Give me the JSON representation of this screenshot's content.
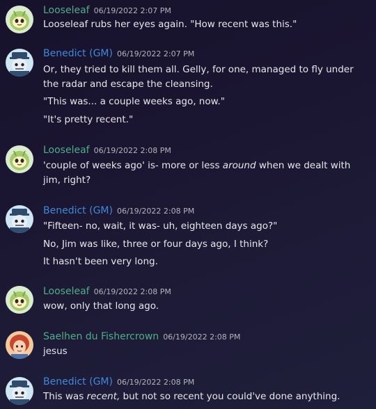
{
  "colors": {
    "loose_name": "#4fae88",
    "gm_name": "#3f89d8",
    "saelhen_name": "#4fae88",
    "text": "#e6e7eb",
    "timestamp": "#b2b4bd"
  },
  "messages": [
    {
      "author": "Looseleaf",
      "timestamp": "06/19/2022 2:07 PM",
      "lines": [
        "Looseleaf rubs her eyes again. \"How recent was this.\""
      ]
    },
    {
      "author": "Benedict (GM)",
      "timestamp": "06/19/2022 2:07 PM",
      "lines": [
        "Or, they tried to kill them all. Gelly, for one, managed to fly under",
        "the radar and escape the cleansing.",
        "\"This was... a couple weeks ago, now.\"",
        "\"It's pretty recent.\""
      ]
    },
    {
      "author": "Looseleaf",
      "timestamp": "06/19/2022 2:08 PM",
      "line1_a": "'couple of weeks ago' is- more or less ",
      "line1_em": "around",
      "line1_b": " when we dealt with",
      "line2": "jim, right?"
    },
    {
      "author": "Benedict (GM)",
      "timestamp": "06/19/2022 2:08 PM",
      "lines": [
        "\"Fifteen- no, wait, it was- uh, eighteen days ago?\"",
        "No, Jim was like, three or four days ago, I think?",
        "It hasn't been very long."
      ]
    },
    {
      "author": "Looseleaf",
      "timestamp": "06/19/2022 2:08 PM",
      "lines": [
        "wow, only that long ago."
      ]
    },
    {
      "author": "Saelhen du Fishercrown",
      "timestamp": "06/19/2022 2:08 PM",
      "lines": [
        "jesus"
      ]
    },
    {
      "author": "Benedict (GM)",
      "timestamp": "06/19/2022 2:08 PM",
      "line1_a": "This was ",
      "line1_em": "recent,",
      "line1_b": " but not so recent you could've done anything."
    }
  ]
}
